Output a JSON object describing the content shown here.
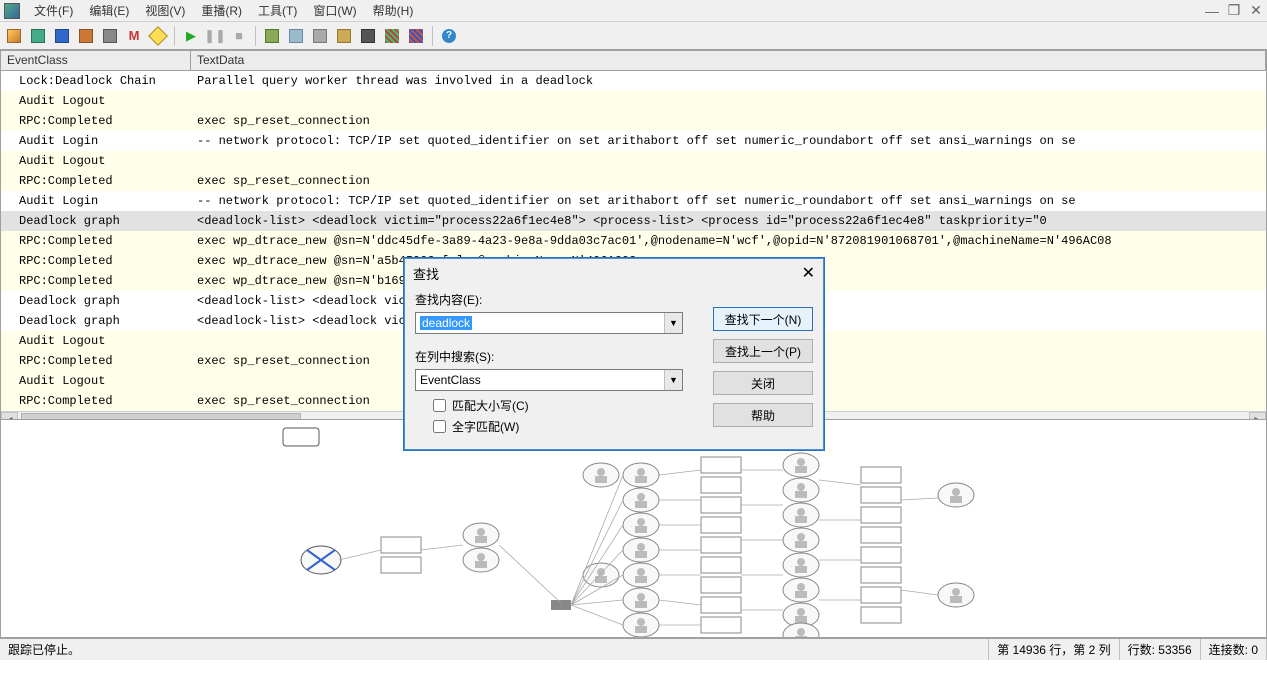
{
  "menubar": {
    "items": [
      {
        "label": "文件(F)"
      },
      {
        "label": "编辑(E)"
      },
      {
        "label": "视图(V)"
      },
      {
        "label": "重播(R)"
      },
      {
        "label": "工具(T)"
      },
      {
        "label": "窗口(W)"
      },
      {
        "label": "帮助(H)"
      }
    ]
  },
  "grid": {
    "headers": {
      "event": "EventClass",
      "text": "TextData"
    },
    "rows": [
      {
        "event": "Lock:Deadlock Chain",
        "text": "Parallel query worker thread was involved in a deadlock",
        "alt": false
      },
      {
        "event": "Audit Logout",
        "text": "",
        "alt": true
      },
      {
        "event": "RPC:Completed",
        "text": "exec sp_reset_connection",
        "alt": true
      },
      {
        "event": "Audit Login",
        "text": "-- network protocol: TCP/IP  set quoted_identifier on  set arithabort off  set numeric_roundabort off  set ansi_warnings on  se",
        "alt": false
      },
      {
        "event": "Audit Logout",
        "text": "",
        "alt": true
      },
      {
        "event": "RPC:Completed",
        "text": "exec sp_reset_connection",
        "alt": true
      },
      {
        "event": "Audit Login",
        "text": "-- network protocol: TCP/IP  set quoted_identifier on  set arithabort off  set numeric_roundabort off  set ansi_warnings on  se",
        "alt": false
      },
      {
        "event": "Deadlock graph",
        "text": "<deadlock-list>  <deadlock victim=\"process22a6f1ec4e8\">   <process-list>    <process id=\"process22a6f1ec4e8\" taskpriority=\"0",
        "alt": false,
        "sel": true
      },
      {
        "event": "RPC:Completed",
        "text": "exec wp_dtrace_new @sn=N'ddc45dfe-3a89-4a23-9e8a-9dda03c7ac01',@nodename=N'wcf',@opid=N'872081901068701',@machineName=N'496AC08",
        "alt": true
      },
      {
        "event": "RPC:Completed",
        "text": "exec wp_dtrace_new @sn=N'a5b45992-[…]                                                      ,@machineName=N'496AC02",
        "alt": true
      },
      {
        "event": "RPC:Completed",
        "text": "exec wp_dtrace_new @sn=N'b169c86a-[…]                                                      ,@machineName=N'496AC02",
        "alt": true
      },
      {
        "event": "Deadlock graph",
        "text": "<deadlock-list>  <deadlock victi[…]                                                       f1ec4e8\" taskpriority=\"0",
        "alt": false
      },
      {
        "event": "Deadlock graph",
        "text": "<deadlock-list>  <deadlock victi[…]                                                       f1ec4e8\" taskpriority=\"0",
        "alt": false
      },
      {
        "event": "Audit Logout",
        "text": "",
        "alt": true
      },
      {
        "event": "RPC:Completed",
        "text": "exec sp_reset_connection",
        "alt": true
      },
      {
        "event": "Audit Logout",
        "text": "",
        "alt": true
      },
      {
        "event": "RPC:Completed",
        "text": "exec sp_reset_connection",
        "alt": true
      }
    ]
  },
  "dialog": {
    "title": "查找",
    "find_label": "查找内容(E):",
    "find_value": "deadlock",
    "column_label": "在列中搜索(S):",
    "column_value": "EventClass",
    "match_case": "匹配大小写(C)",
    "whole_word": "全字匹配(W)",
    "btn_next": "查找下一个(N)",
    "btn_prev": "查找上一个(P)",
    "btn_close": "关闭",
    "btn_help": "帮助"
  },
  "status": {
    "trace": "跟踪已停止。",
    "pos": "第 14936 行，第 2 列",
    "rows": "行数: 53356",
    "conn": "连接数: 0"
  }
}
